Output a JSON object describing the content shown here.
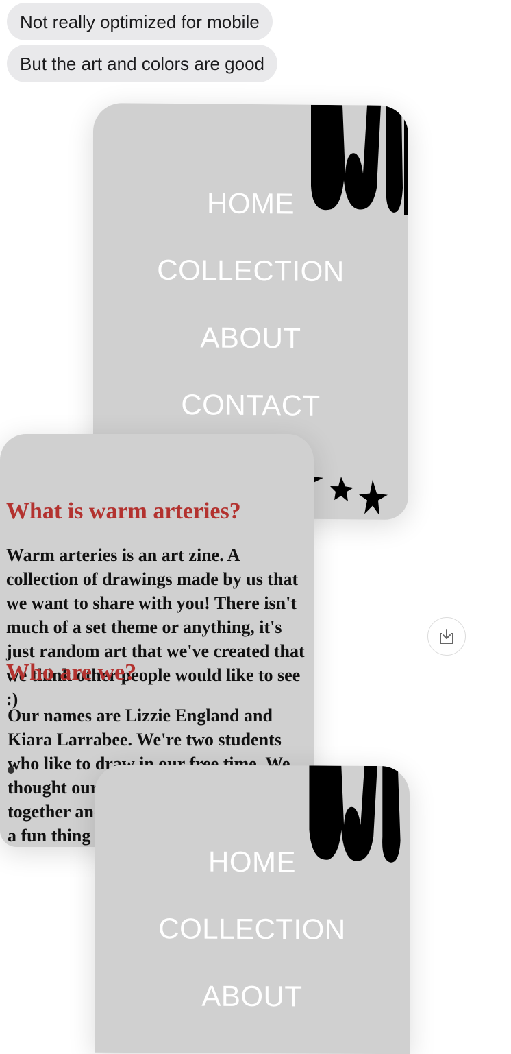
{
  "messages": [
    {
      "text": "Not really optimized for mobile"
    },
    {
      "text": "But the art and colors are good"
    }
  ],
  "screenshot_1": {
    "menu": [
      "HOME",
      "COLLECTION",
      "ABOUT",
      "CONTACT"
    ],
    "logo_partial_text": "WI"
  },
  "screenshot_2": {
    "section_1_title": "What is warm arteries?",
    "section_1_text": "Warm arteries is an art zine. A collection of drawings made by us that we want to share with you! There isn't much of a set theme or anything, it's just random art that we've created that we think other people would like to see :)",
    "section_2_title": "Who are we?",
    "section_2_text": "Our names are Lizzie England and Kiara Larrabee. We're two students who like to draw in our free time. We thought our art styles went well together and thought that this would be a fun thing to do"
  },
  "screenshot_3": {
    "menu": [
      "HOME",
      "COLLECTION",
      "ABOUT"
    ],
    "logo_partial_text": "WI"
  },
  "colors": {
    "bubble_bg": "#e9e9eb",
    "card_bg": "#d0d0d0",
    "heading_red": "#b3322f"
  }
}
